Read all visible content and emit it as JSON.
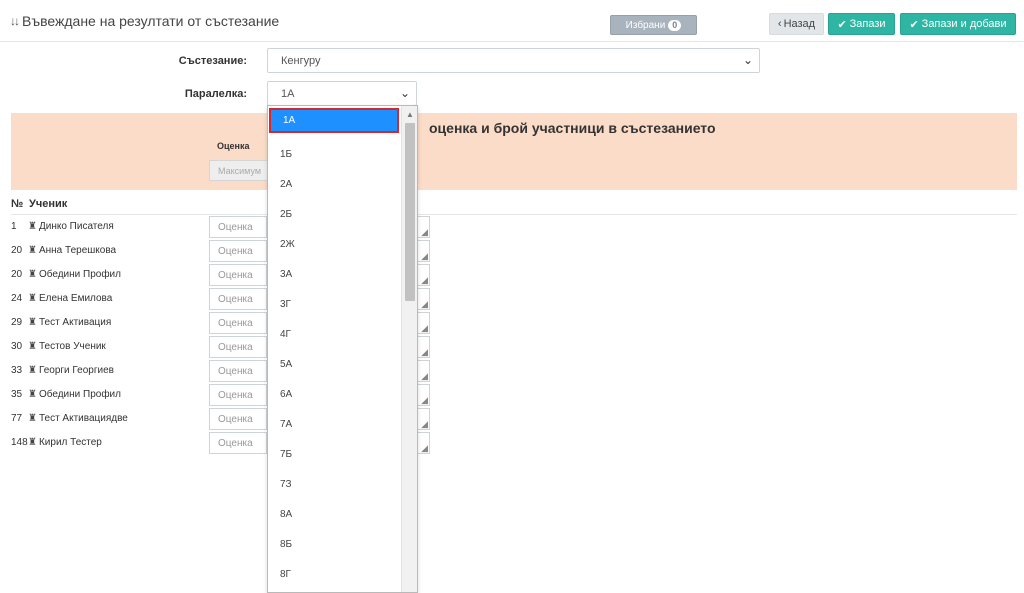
{
  "header": {
    "title": "Въвеждане на резултати от състезание",
    "sort_icon": "↓↓",
    "favorites_label": "Избрани",
    "favorites_count": "0",
    "back_label": "Назад",
    "back_icon": "‹",
    "save_label": "Запази",
    "save_add_label": "Запази и добави",
    "check_icon": "✔"
  },
  "form": {
    "competition_label": "Състезание:",
    "competition_value": "Кенгуру",
    "class_label": "Паралелка:",
    "class_value": "1А",
    "chevron_icon": "⌄"
  },
  "panel": {
    "title": "оценка и брой участници в състезанието",
    "grade_label": "Оценка",
    "max_placeholder": "Максимум"
  },
  "table": {
    "col_no": "№",
    "col_student": "Ученик",
    "grade_placeholder": "Оценка",
    "student_icon": "♜",
    "rows": [
      {
        "no": "1",
        "name": "Динко Писателя"
      },
      {
        "no": "20",
        "name": "Анна Терешкова"
      },
      {
        "no": "20",
        "name": "Обедини Профил"
      },
      {
        "no": "24",
        "name": "Елена Емилова"
      },
      {
        "no": "29",
        "name": "Тест Активация"
      },
      {
        "no": "30",
        "name": "Тестов Ученик"
      },
      {
        "no": "33",
        "name": "Георги Георгиев"
      },
      {
        "no": "35",
        "name": "Обедини Профил"
      },
      {
        "no": "77",
        "name": "Тест Активациядве"
      },
      {
        "no": "148",
        "name": "Кирил Тестер"
      }
    ]
  },
  "dropdown": {
    "selected_index": 0,
    "options": [
      "1А",
      "1Б",
      "2А",
      "2Б",
      "2Ж",
      "3А",
      "3Г",
      "4Г",
      "5А",
      "6А",
      "7А",
      "7Б",
      "7З",
      "8А",
      "8Б",
      "8Г"
    ]
  },
  "colors": {
    "accent": "#2fb5a3",
    "panel_bg": "#fbdcc8",
    "selected_option": "#1e90ff",
    "highlight_border": "#d8262d"
  }
}
